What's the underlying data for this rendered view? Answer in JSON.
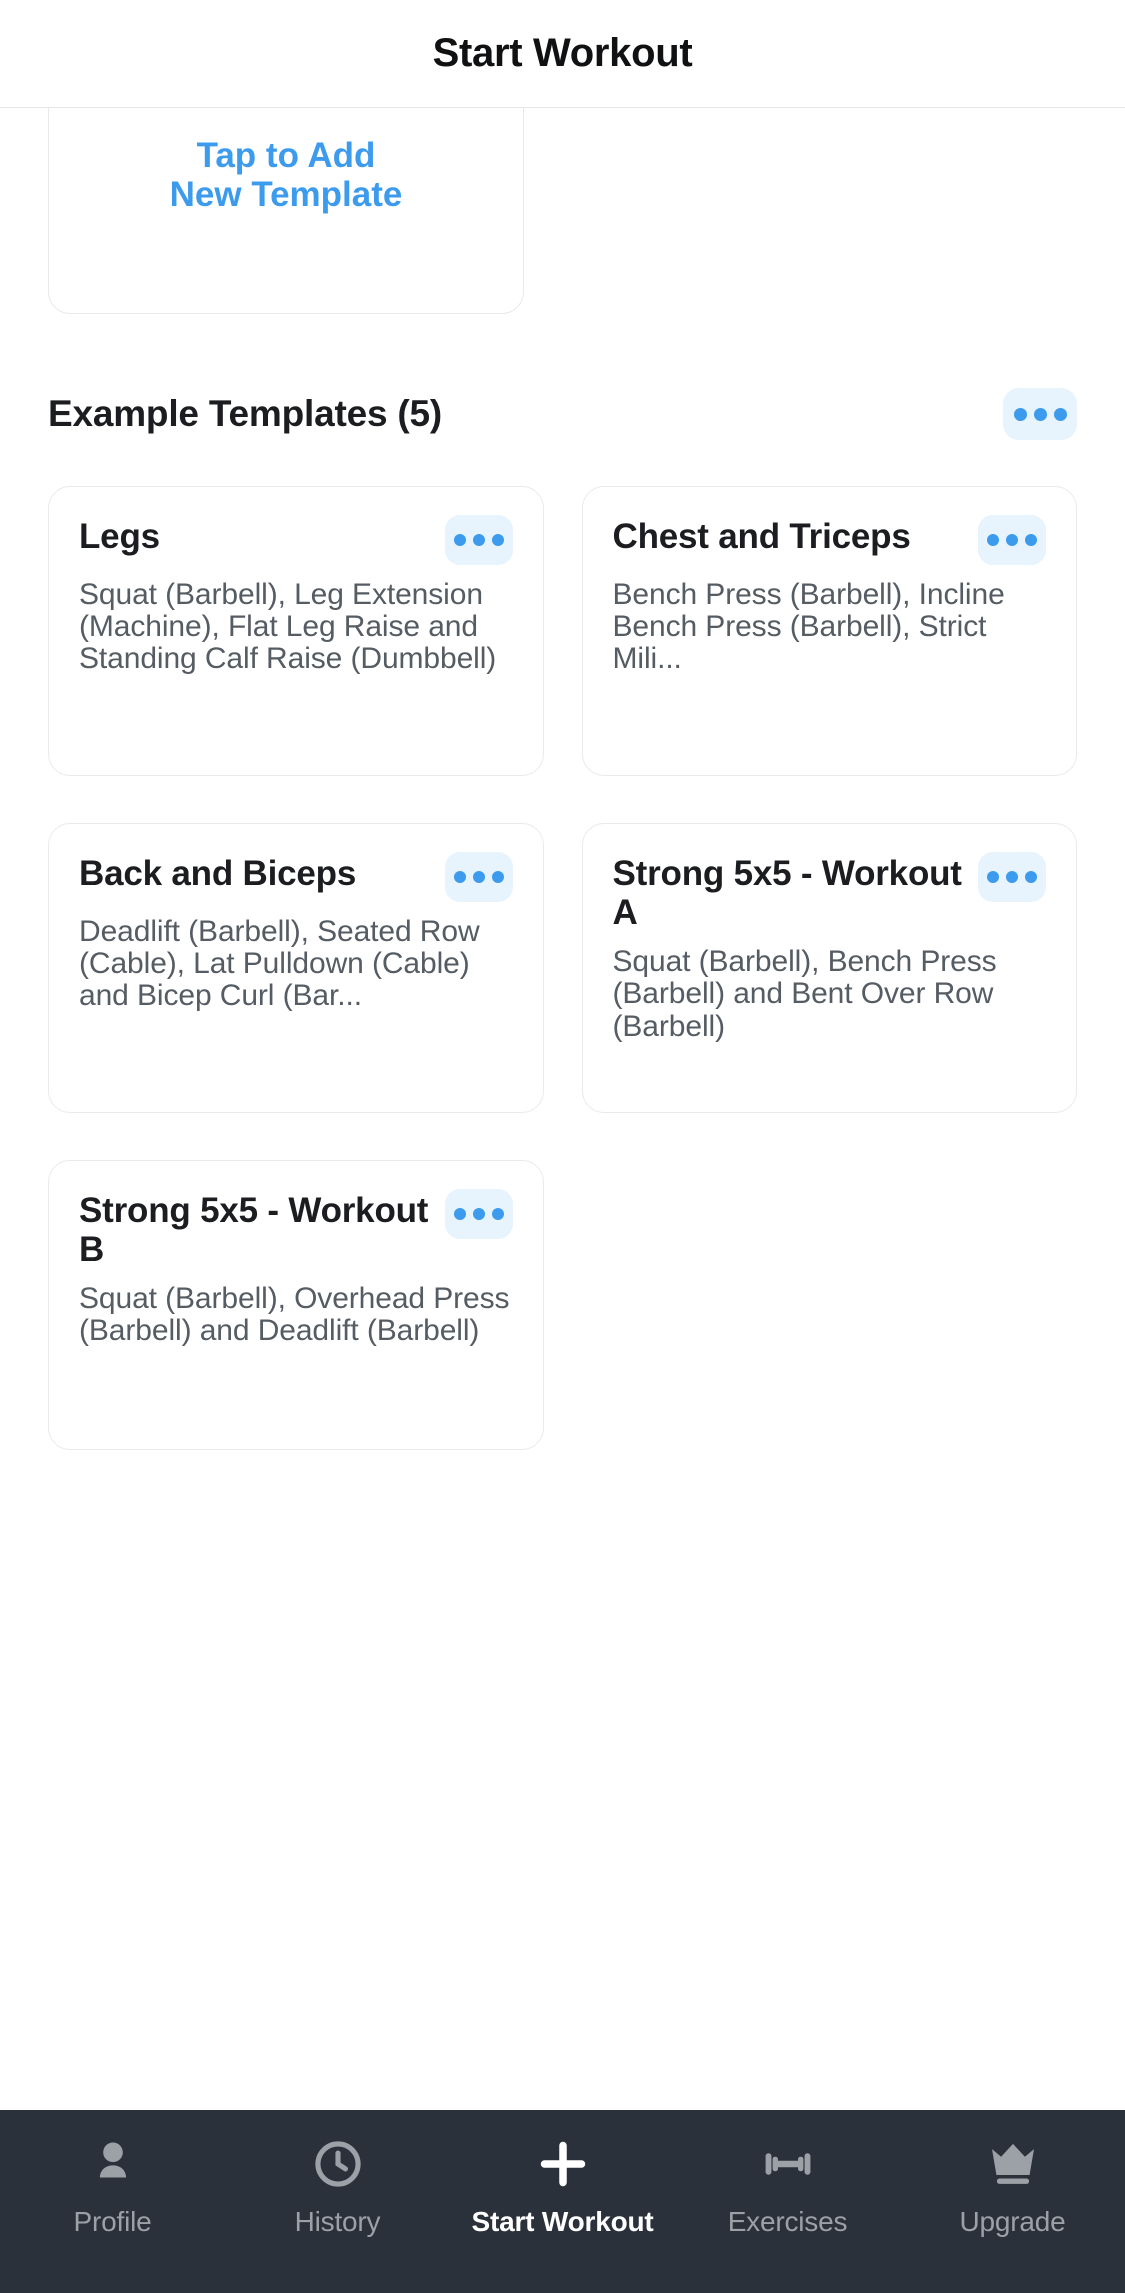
{
  "header": {
    "title": "Start Workout"
  },
  "add_template_card": {
    "label": "Tap to Add\nNew Template",
    "accent_color": "#3d9bee"
  },
  "section": {
    "title": "Example Templates (5)",
    "menu_icon": "ellipsis-icon"
  },
  "templates": [
    {
      "name": "Legs",
      "exercises": "Squat (Barbell), Leg Extension (Machine), Flat Leg Raise and Standing Calf Raise (Dumbbell)",
      "menu_icon": "ellipsis-icon"
    },
    {
      "name": "Chest and Triceps",
      "exercises": "Bench Press (Barbell), Incline Bench Press (Barbell), Strict Mili...",
      "menu_icon": "ellipsis-icon"
    },
    {
      "name": "Back and Biceps",
      "exercises": "Deadlift (Barbell), Seated Row (Cable), Lat Pulldown (Cable) and Bicep Curl (Bar...",
      "menu_icon": "ellipsis-icon"
    },
    {
      "name": "Strong 5x5 - Workout A",
      "exercises": "Squat (Barbell), Bench Press (Barbell) and Bent Over Row (Barbell)",
      "menu_icon": "ellipsis-icon"
    },
    {
      "name": "Strong 5x5 - Workout B",
      "exercises": "Squat (Barbell), Overhead Press (Barbell) and Deadlift (Barbell)",
      "menu_icon": "ellipsis-icon"
    }
  ],
  "tabbar": {
    "background": "#2b313a",
    "active_color": "#ffffff",
    "inactive_color": "#9ca1a7",
    "items": [
      {
        "label": "Profile",
        "icon": "person-icon",
        "active": false
      },
      {
        "label": "History",
        "icon": "clock-icon",
        "active": false
      },
      {
        "label": "Start Workout",
        "icon": "plus-icon",
        "active": true
      },
      {
        "label": "Exercises",
        "icon": "dumbbell-icon",
        "active": false
      },
      {
        "label": "Upgrade",
        "icon": "crown-icon",
        "active": false
      }
    ]
  }
}
